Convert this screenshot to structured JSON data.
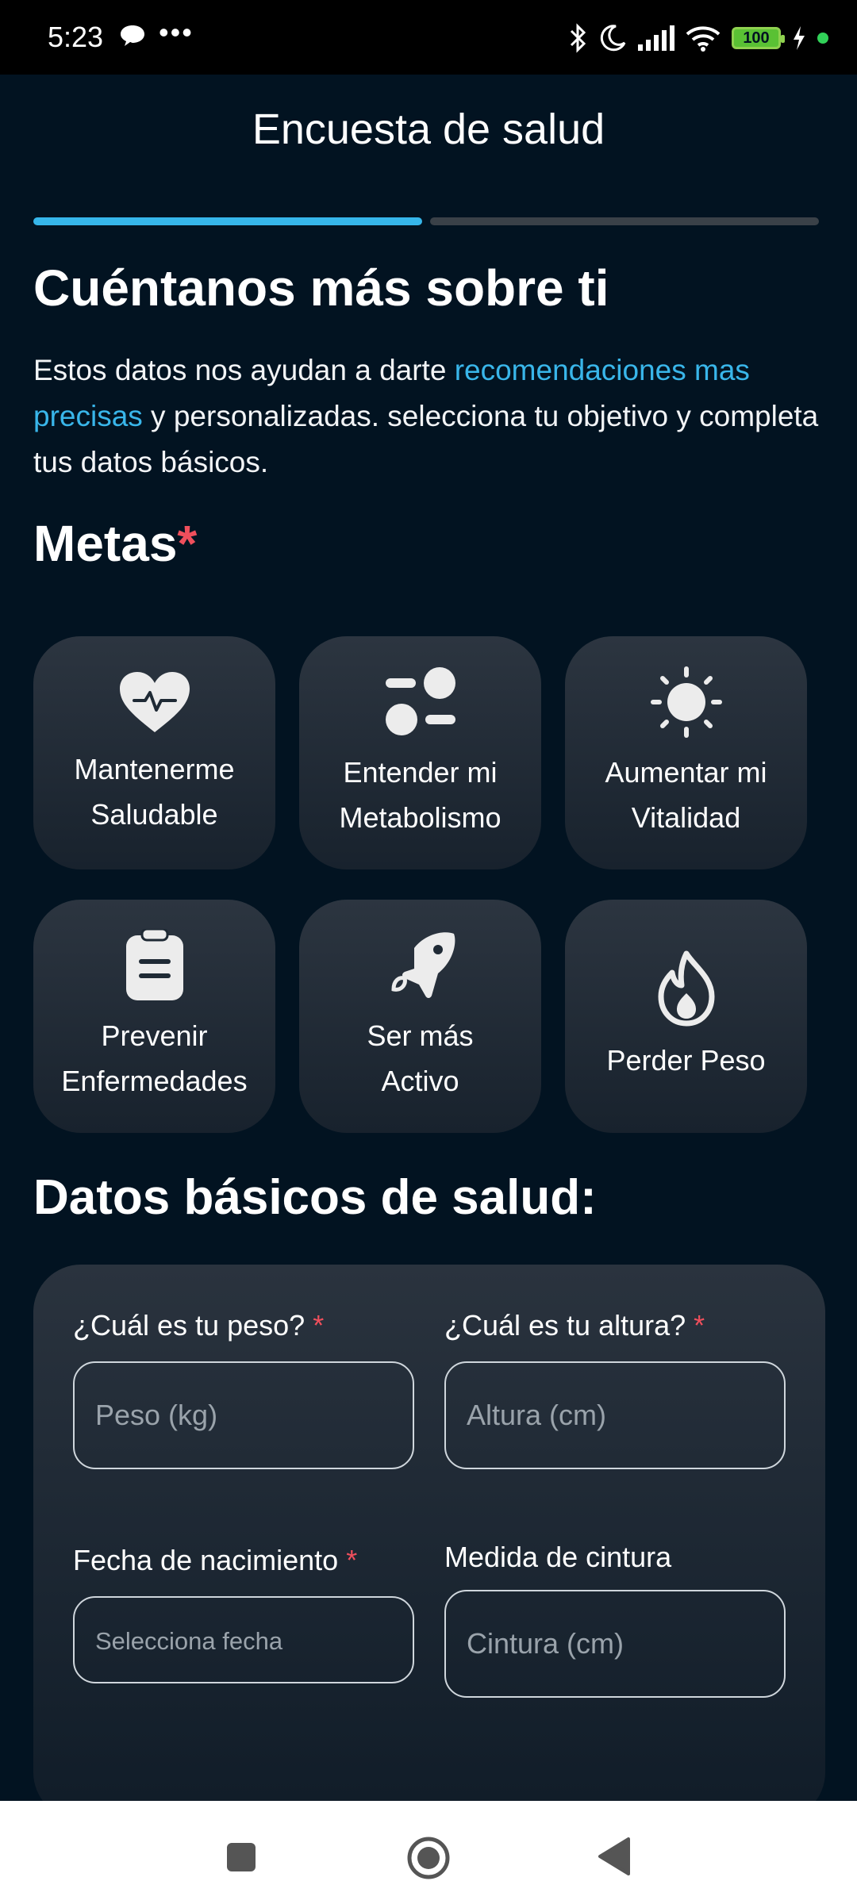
{
  "status": {
    "time": "5:23",
    "dots": "•••",
    "battery": "100"
  },
  "header": {
    "title": "Encuesta de salud",
    "progress_step": 1,
    "progress_total": 2
  },
  "intro": {
    "heading": "Cuéntanos más sobre ti",
    "text_1": "Estos datos nos ayudan a darte ",
    "highlight": "recomendaciones mas precisas",
    "text_2": " y personalizadas. selecciona tu objetivo y completa tus datos básicos."
  },
  "goals": {
    "title": "Metas",
    "required_mark": "*",
    "items": [
      {
        "line1": "Mantenerme",
        "line2": "Saludable",
        "icon": "heart-pulse-icon"
      },
      {
        "line1": "Entender mi",
        "line2": "Metabolismo",
        "icon": "metabolism-icon"
      },
      {
        "line1": "Aumentar mi",
        "line2": "Vitalidad",
        "icon": "sun-icon"
      },
      {
        "line1": "Prevenir",
        "line2": "Enfermedades",
        "icon": "clipboard-icon"
      },
      {
        "line1": "Ser más",
        "line2": "Activo",
        "icon": "rocket-icon"
      },
      {
        "line1": "Perder Peso",
        "line2": "",
        "icon": "fire-icon"
      }
    ]
  },
  "basic": {
    "title": "Datos básicos de salud:",
    "weight_label": "¿Cuál es tu peso?",
    "weight_placeholder": "Peso (kg)",
    "height_label": "¿Cuál es tu altura?",
    "height_placeholder": "Altura (cm)",
    "birth_label": "Fecha de nacimiento",
    "birth_placeholder": "Selecciona fecha",
    "waist_label": "Medida de cintura",
    "waist_placeholder": "Cintura (cm)",
    "required_mark": "*"
  },
  "colors": {
    "accent": "#36b6ea",
    "required": "#ef4f5c",
    "background": "#021321"
  }
}
